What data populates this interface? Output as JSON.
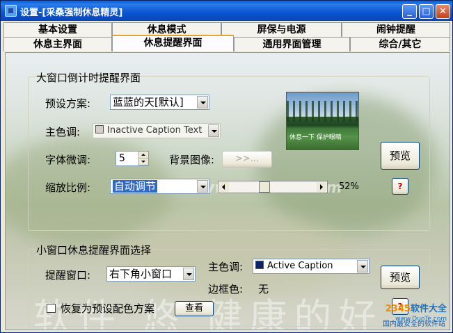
{
  "window": {
    "title": "设置-[采桑强制休息精灵]",
    "minimize_label": "_",
    "maximize_label": "□",
    "close_label": "✕"
  },
  "tabs_row1": [
    {
      "label": "基本设置"
    },
    {
      "label": "休息模式"
    },
    {
      "label": "屏保与电源"
    },
    {
      "label": "闹钟提醒"
    }
  ],
  "tabs_row2": [
    {
      "label": "休息主界面"
    },
    {
      "label": "休息提醒界面",
      "active": true
    },
    {
      "label": "通用界面管理"
    },
    {
      "label": "综合/其它"
    }
  ],
  "large_group": {
    "title": "大窗口倒计时提醒界面",
    "preset_label": "预设方案:",
    "preset_value": "蓝蓝的天[默认]",
    "main_color_label": "主色调:",
    "main_color_value": "Inactive Caption Text",
    "main_color_swatch": "#d4d0c8",
    "font_adjust_label": "字体微调:",
    "font_adjust_value": "5",
    "bg_image_label": "背景图像:",
    "bg_image_button": ">>...",
    "scale_label": "缩放比例:",
    "scale_value": "自动调节",
    "scale_percent_text": "52%",
    "scale_fraction": 0.52,
    "preview_button": "预览",
    "help_button": "?",
    "preview_image_text": "休息一下 保护眼睛"
  },
  "small_group": {
    "title": "小窗口休息提醒界面选择",
    "remind_window_label": "提醒窗口:",
    "remind_window_value": "右下角小窗口",
    "main_color_label": "主色调:",
    "main_color_value": "Active Caption",
    "main_color_swatch": "#0a246a",
    "border_color_label": "边框色:",
    "border_color_value": "无",
    "preview_button": "预览",
    "help_button": "?",
    "restore_label": "恢复为预设配色方案",
    "view_button": "查看"
  },
  "background": {
    "watermark_text": "软件 悠 健康的好",
    "site_watermark": "www.DuoTe.com"
  },
  "badge": {
    "brand_part1": "2345",
    "brand_part2": "软件大全",
    "url": "www.DuoTe.com",
    "slogan": "国内最安全的软件站"
  }
}
